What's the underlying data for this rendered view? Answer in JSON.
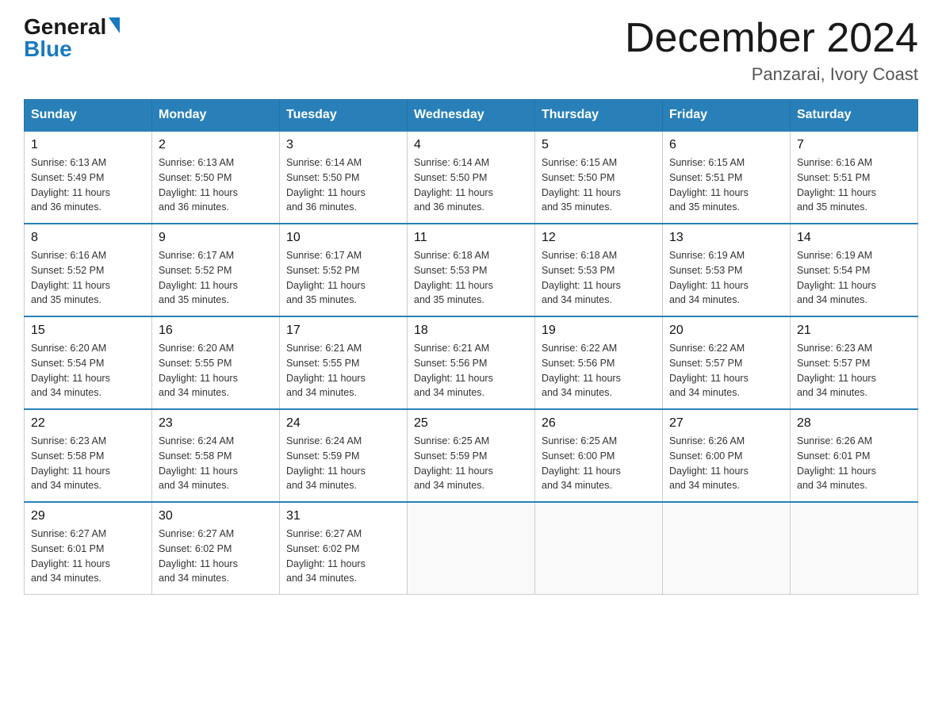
{
  "logo": {
    "general": "General",
    "blue": "Blue"
  },
  "header": {
    "month": "December 2024",
    "location": "Panzarai, Ivory Coast"
  },
  "weekdays": [
    "Sunday",
    "Monday",
    "Tuesday",
    "Wednesday",
    "Thursday",
    "Friday",
    "Saturday"
  ],
  "weeks": [
    [
      {
        "day": "1",
        "sunrise": "6:13 AM",
        "sunset": "5:49 PM",
        "daylight": "11 hours and 36 minutes."
      },
      {
        "day": "2",
        "sunrise": "6:13 AM",
        "sunset": "5:50 PM",
        "daylight": "11 hours and 36 minutes."
      },
      {
        "day": "3",
        "sunrise": "6:14 AM",
        "sunset": "5:50 PM",
        "daylight": "11 hours and 36 minutes."
      },
      {
        "day": "4",
        "sunrise": "6:14 AM",
        "sunset": "5:50 PM",
        "daylight": "11 hours and 36 minutes."
      },
      {
        "day": "5",
        "sunrise": "6:15 AM",
        "sunset": "5:50 PM",
        "daylight": "11 hours and 35 minutes."
      },
      {
        "day": "6",
        "sunrise": "6:15 AM",
        "sunset": "5:51 PM",
        "daylight": "11 hours and 35 minutes."
      },
      {
        "day": "7",
        "sunrise": "6:16 AM",
        "sunset": "5:51 PM",
        "daylight": "11 hours and 35 minutes."
      }
    ],
    [
      {
        "day": "8",
        "sunrise": "6:16 AM",
        "sunset": "5:52 PM",
        "daylight": "11 hours and 35 minutes."
      },
      {
        "day": "9",
        "sunrise": "6:17 AM",
        "sunset": "5:52 PM",
        "daylight": "11 hours and 35 minutes."
      },
      {
        "day": "10",
        "sunrise": "6:17 AM",
        "sunset": "5:52 PM",
        "daylight": "11 hours and 35 minutes."
      },
      {
        "day": "11",
        "sunrise": "6:18 AM",
        "sunset": "5:53 PM",
        "daylight": "11 hours and 35 minutes."
      },
      {
        "day": "12",
        "sunrise": "6:18 AM",
        "sunset": "5:53 PM",
        "daylight": "11 hours and 34 minutes."
      },
      {
        "day": "13",
        "sunrise": "6:19 AM",
        "sunset": "5:53 PM",
        "daylight": "11 hours and 34 minutes."
      },
      {
        "day": "14",
        "sunrise": "6:19 AM",
        "sunset": "5:54 PM",
        "daylight": "11 hours and 34 minutes."
      }
    ],
    [
      {
        "day": "15",
        "sunrise": "6:20 AM",
        "sunset": "5:54 PM",
        "daylight": "11 hours and 34 minutes."
      },
      {
        "day": "16",
        "sunrise": "6:20 AM",
        "sunset": "5:55 PM",
        "daylight": "11 hours and 34 minutes."
      },
      {
        "day": "17",
        "sunrise": "6:21 AM",
        "sunset": "5:55 PM",
        "daylight": "11 hours and 34 minutes."
      },
      {
        "day": "18",
        "sunrise": "6:21 AM",
        "sunset": "5:56 PM",
        "daylight": "11 hours and 34 minutes."
      },
      {
        "day": "19",
        "sunrise": "6:22 AM",
        "sunset": "5:56 PM",
        "daylight": "11 hours and 34 minutes."
      },
      {
        "day": "20",
        "sunrise": "6:22 AM",
        "sunset": "5:57 PM",
        "daylight": "11 hours and 34 minutes."
      },
      {
        "day": "21",
        "sunrise": "6:23 AM",
        "sunset": "5:57 PM",
        "daylight": "11 hours and 34 minutes."
      }
    ],
    [
      {
        "day": "22",
        "sunrise": "6:23 AM",
        "sunset": "5:58 PM",
        "daylight": "11 hours and 34 minutes."
      },
      {
        "day": "23",
        "sunrise": "6:24 AM",
        "sunset": "5:58 PM",
        "daylight": "11 hours and 34 minutes."
      },
      {
        "day": "24",
        "sunrise": "6:24 AM",
        "sunset": "5:59 PM",
        "daylight": "11 hours and 34 minutes."
      },
      {
        "day": "25",
        "sunrise": "6:25 AM",
        "sunset": "5:59 PM",
        "daylight": "11 hours and 34 minutes."
      },
      {
        "day": "26",
        "sunrise": "6:25 AM",
        "sunset": "6:00 PM",
        "daylight": "11 hours and 34 minutes."
      },
      {
        "day": "27",
        "sunrise": "6:26 AM",
        "sunset": "6:00 PM",
        "daylight": "11 hours and 34 minutes."
      },
      {
        "day": "28",
        "sunrise": "6:26 AM",
        "sunset": "6:01 PM",
        "daylight": "11 hours and 34 minutes."
      }
    ],
    [
      {
        "day": "29",
        "sunrise": "6:27 AM",
        "sunset": "6:01 PM",
        "daylight": "11 hours and 34 minutes."
      },
      {
        "day": "30",
        "sunrise": "6:27 AM",
        "sunset": "6:02 PM",
        "daylight": "11 hours and 34 minutes."
      },
      {
        "day": "31",
        "sunrise": "6:27 AM",
        "sunset": "6:02 PM",
        "daylight": "11 hours and 34 minutes."
      },
      null,
      null,
      null,
      null
    ]
  ],
  "labels": {
    "sunrise": "Sunrise:",
    "sunset": "Sunset:",
    "daylight": "Daylight:"
  }
}
